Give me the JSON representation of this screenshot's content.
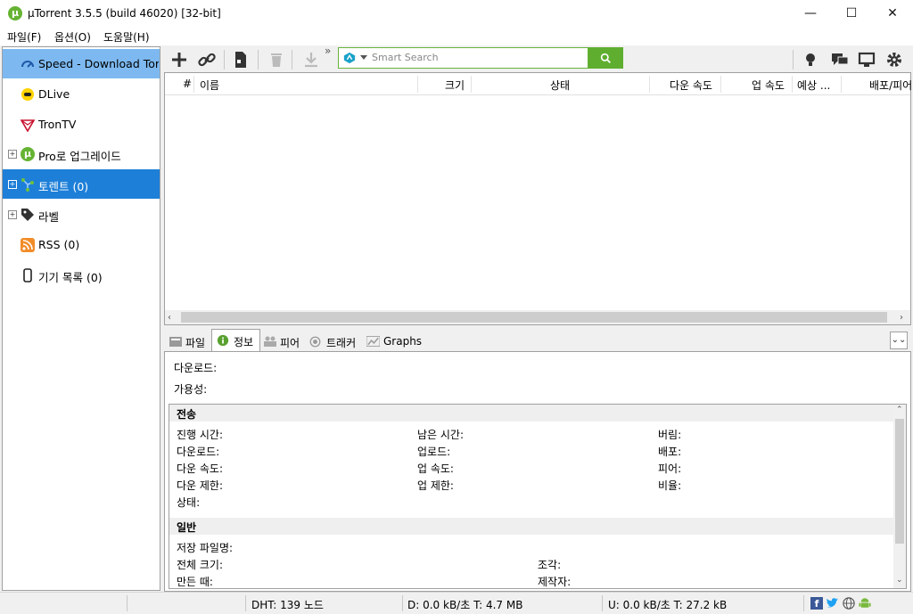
{
  "window": {
    "title": "µTorrent 3.5.5  (build 46020) [32-bit]",
    "logo_letter": "µ",
    "minimize": "—",
    "maximize": "☐",
    "close": "✕"
  },
  "menu": [
    "파일(F)",
    "옵션(O)",
    "도움말(H)"
  ],
  "sidebar": {
    "items": [
      {
        "label": "Speed - Download Torre",
        "icon": "speed-gauge-icon"
      },
      {
        "label": "DLive",
        "icon": "dlive-icon"
      },
      {
        "label": "TronTV",
        "icon": "trontv-icon"
      },
      {
        "label": "Pro로 업그레이드",
        "icon": "utorrent-logo-icon"
      },
      {
        "label": "토렌트 (0)",
        "icon": "torrents-icon"
      },
      {
        "label": "라벨",
        "icon": "tag-icon"
      },
      {
        "label": "RSS (0)",
        "icon": "rss-icon"
      },
      {
        "label": "기기 목록 (0)",
        "icon": "device-icon"
      }
    ]
  },
  "search": {
    "placeholder": "Smart Search"
  },
  "toolbar": {
    "more": "»"
  },
  "list": {
    "columns": [
      "#",
      "이름",
      "크기",
      "상태",
      "다운 속도",
      "업 속도",
      "예상 ...",
      "배포/피어"
    ]
  },
  "tabs": [
    "파일",
    "정보",
    "피어",
    "트래커",
    "Graphs"
  ],
  "info": {
    "download_label": "다운로드:",
    "availability_label": "가용성:",
    "transfer_section": "전송",
    "transfer": {
      "col1": [
        "진행 시간:",
        "다운로드:",
        "다운 속도:",
        "다운 제한:",
        "상태:"
      ],
      "col2": [
        "남은 시간:",
        "업로드:",
        "업 속도:",
        "업 제한:"
      ],
      "col3": [
        "버림:",
        "배포:",
        "피어:",
        "비율:"
      ]
    },
    "general_section": "일반",
    "general": {
      "col1": [
        "저장 파일명:",
        "전체 크기:",
        "만든 때:"
      ],
      "col2": [
        "조각:",
        "제작자:"
      ]
    }
  },
  "status": {
    "dht": "DHT: 139 노드",
    "download": "D: 0.0 kB/초 T: 4.7 MB",
    "upload": "U: 0.0 kB/초 T: 27.2 kB"
  },
  "colors": {
    "accent": "#1e7fd8",
    "brand_green": "#66b334",
    "selection_light": "#7db9f0"
  }
}
